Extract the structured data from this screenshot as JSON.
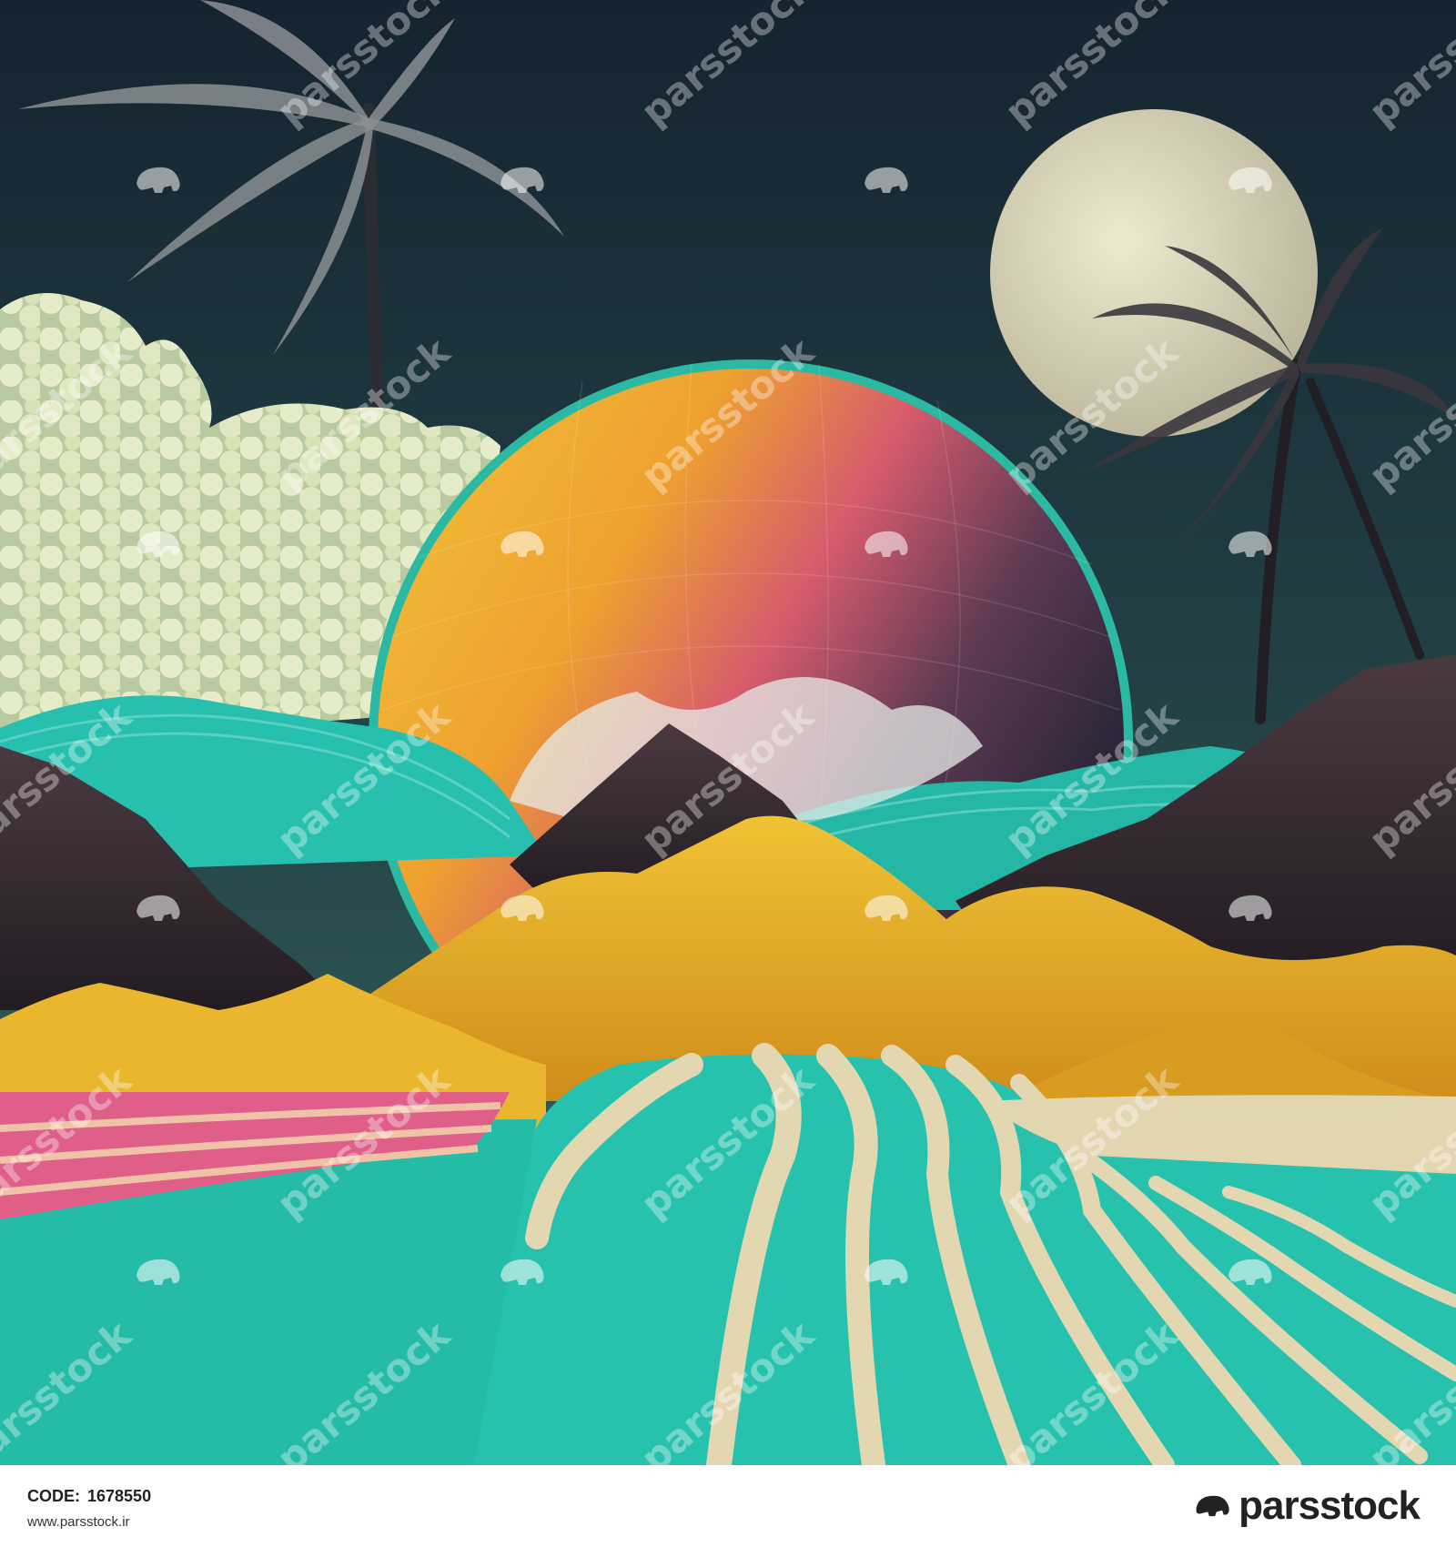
{
  "footer": {
    "code_label": "CODE:",
    "code_value": "1678550",
    "url": "www.parsstock.ir",
    "brand": "parsstock"
  },
  "watermark": {
    "text": "parsstock",
    "icon": "elephant-logo-icon"
  },
  "scene": {
    "description_icons": [
      "moon",
      "planet",
      "palm-tree",
      "mountain",
      "sand-dune",
      "wave",
      "cloud"
    ]
  },
  "colors": {
    "sky_top": "#142430",
    "sky_bottom": "#2d5a5a",
    "teal": "#27c4b0",
    "sand": "#e8b52c",
    "pink": "#e2638a",
    "cream": "#e6dbb8",
    "rock": "#3b2e33",
    "moon": "#d9d4b8"
  }
}
